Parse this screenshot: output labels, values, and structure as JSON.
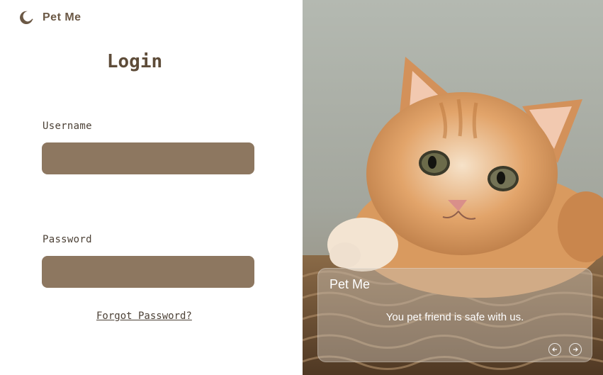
{
  "brand": {
    "name": "Pet Me",
    "icon": "moon-icon",
    "color": "#6b5845"
  },
  "login": {
    "title": "Login",
    "username_label": "Username",
    "username_value": "",
    "password_label": "Password",
    "password_value": "",
    "forgot_password": "Forgot Password?"
  },
  "card": {
    "title": "Pet Me",
    "text": "You pet friend is safe with us.",
    "prev_icon": "arrow-left-icon",
    "next_icon": "arrow-right-icon"
  },
  "colors": {
    "accent": "#8d7760",
    "heading": "#5e4c39"
  }
}
